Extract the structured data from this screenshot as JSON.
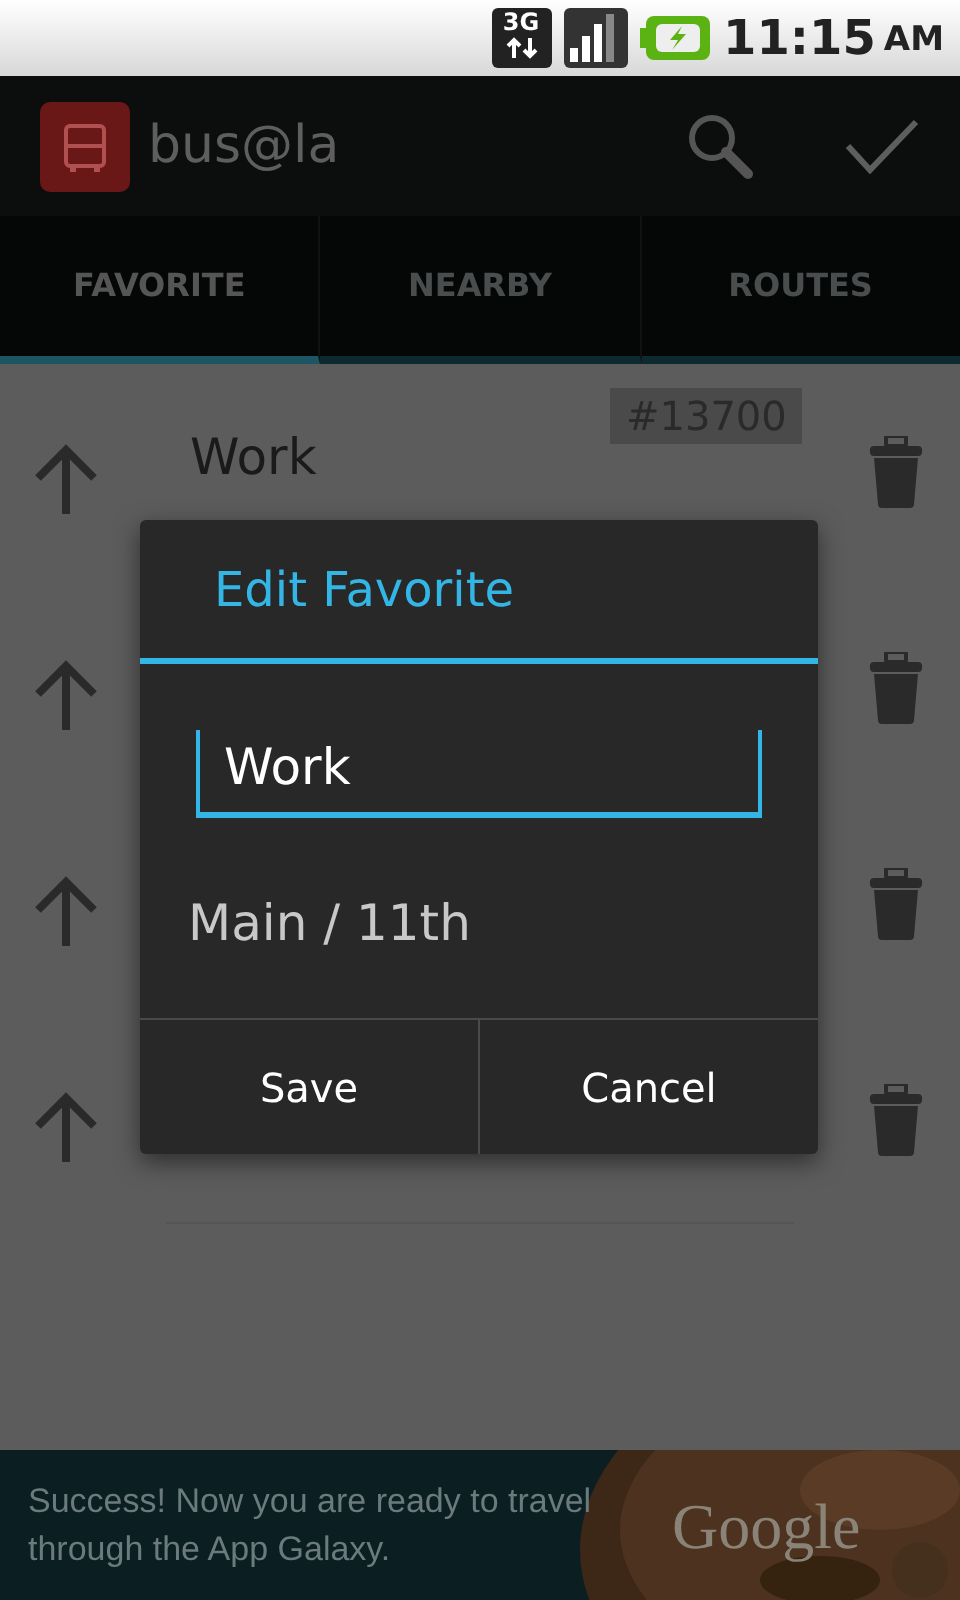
{
  "status_bar": {
    "network": "3G",
    "time": "11:15",
    "period": "AM"
  },
  "action_bar": {
    "title": "bus@la"
  },
  "tabs": [
    {
      "label": "FAVORITE",
      "selected": true
    },
    {
      "label": "NEARBY",
      "selected": false
    },
    {
      "label": "ROUTES",
      "selected": false
    }
  ],
  "favorites": [
    {
      "kind": "favorite",
      "name": "Work",
      "stop": "#13700"
    },
    {
      "kind": "favorite"
    },
    {
      "kind": "favorite"
    },
    {
      "kind": "favorite"
    }
  ],
  "dialog": {
    "title": "Edit Favorite",
    "name_value": "Work",
    "location": "Main / 11th",
    "buttons": [
      "Save",
      "Cancel"
    ]
  },
  "ad": {
    "text": "Success! Now you are ready to travel through the App Galaxy.",
    "brand": "Google"
  }
}
